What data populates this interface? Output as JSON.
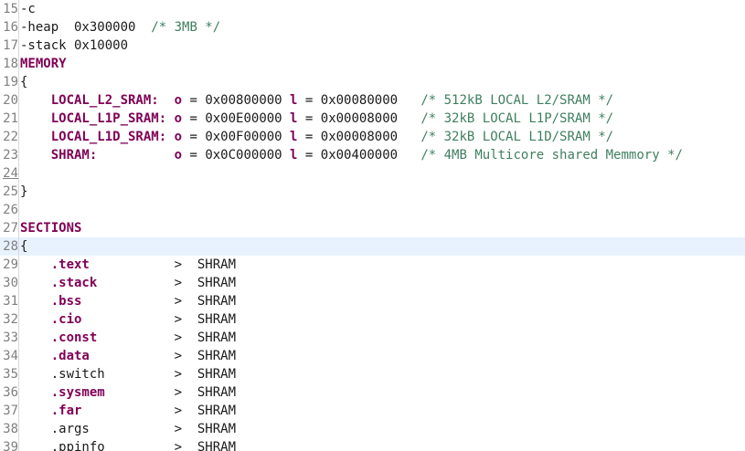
{
  "editor": {
    "current_line": 28,
    "lines": [
      {
        "num": "15",
        "parts": [
          {
            "t": "-c",
            "c": "plain"
          }
        ]
      },
      {
        "num": "16",
        "parts": [
          {
            "t": "-heap  0x300000  ",
            "c": "plain"
          },
          {
            "t": "/* 3MB */",
            "c": "cm"
          }
        ]
      },
      {
        "num": "17",
        "parts": [
          {
            "t": "-stack 0x10000",
            "c": "plain"
          }
        ]
      },
      {
        "num": "18",
        "parts": [
          {
            "t": "MEMORY",
            "c": "kw"
          }
        ]
      },
      {
        "num": "19",
        "parts": [
          {
            "t": "{",
            "c": "plain"
          }
        ]
      },
      {
        "num": "20",
        "parts": [
          {
            "t": "    ",
            "c": "plain"
          },
          {
            "t": "LOCAL_L2_SRAM:",
            "c": "kw"
          },
          {
            "t": "  ",
            "c": "plain"
          },
          {
            "t": "o",
            "c": "kw"
          },
          {
            "t": " = 0x00800000 ",
            "c": "plain"
          },
          {
            "t": "l",
            "c": "kw"
          },
          {
            "t": " = 0x00080000   ",
            "c": "plain"
          },
          {
            "t": "/* 512kB LOCAL L2/SRAM */",
            "c": "cm"
          }
        ]
      },
      {
        "num": "21",
        "parts": [
          {
            "t": "    ",
            "c": "plain"
          },
          {
            "t": "LOCAL_L1P_SRAM:",
            "c": "kw"
          },
          {
            "t": " ",
            "c": "plain"
          },
          {
            "t": "o",
            "c": "kw"
          },
          {
            "t": " = 0x00E00000 ",
            "c": "plain"
          },
          {
            "t": "l",
            "c": "kw"
          },
          {
            "t": " = 0x00008000   ",
            "c": "plain"
          },
          {
            "t": "/* 32kB LOCAL L1P/SRAM */",
            "c": "cm"
          }
        ]
      },
      {
        "num": "22",
        "parts": [
          {
            "t": "    ",
            "c": "plain"
          },
          {
            "t": "LOCAL_L1D_SRAM:",
            "c": "kw"
          },
          {
            "t": " ",
            "c": "plain"
          },
          {
            "t": "o",
            "c": "kw"
          },
          {
            "t": " = 0x00F00000 ",
            "c": "plain"
          },
          {
            "t": "l",
            "c": "kw"
          },
          {
            "t": " = 0x00008000   ",
            "c": "plain"
          },
          {
            "t": "/* 32kB LOCAL L1D/SRAM */",
            "c": "cm"
          }
        ]
      },
      {
        "num": "23",
        "parts": [
          {
            "t": "    ",
            "c": "plain"
          },
          {
            "t": "SHRAM:",
            "c": "kw"
          },
          {
            "t": "          ",
            "c": "plain"
          },
          {
            "t": "o",
            "c": "kw"
          },
          {
            "t": " = 0x0C000000 ",
            "c": "plain"
          },
          {
            "t": "l",
            "c": "kw"
          },
          {
            "t": " = 0x00400000   ",
            "c": "plain"
          },
          {
            "t": "/* 4MB Multicore shared Memmory */",
            "c": "cm"
          }
        ]
      },
      {
        "num": "24",
        "underline": true,
        "parts": []
      },
      {
        "num": "25",
        "parts": [
          {
            "t": "}",
            "c": "plain"
          }
        ]
      },
      {
        "num": "26",
        "parts": []
      },
      {
        "num": "27",
        "parts": [
          {
            "t": "SECTIONS",
            "c": "kw"
          }
        ]
      },
      {
        "num": "28",
        "parts": [
          {
            "t": "{",
            "c": "plain"
          }
        ]
      },
      {
        "num": "29",
        "parts": [
          {
            "t": "    ",
            "c": "plain"
          },
          {
            "t": ".text",
            "c": "kw"
          },
          {
            "t": "           >  SHRAM",
            "c": "plain"
          }
        ]
      },
      {
        "num": "30",
        "parts": [
          {
            "t": "    ",
            "c": "plain"
          },
          {
            "t": ".stack",
            "c": "kw"
          },
          {
            "t": "          >  SHRAM",
            "c": "plain"
          }
        ]
      },
      {
        "num": "31",
        "parts": [
          {
            "t": "    ",
            "c": "plain"
          },
          {
            "t": ".bss",
            "c": "kw"
          },
          {
            "t": "            >  SHRAM",
            "c": "plain"
          }
        ]
      },
      {
        "num": "32",
        "parts": [
          {
            "t": "    ",
            "c": "plain"
          },
          {
            "t": ".cio",
            "c": "kw"
          },
          {
            "t": "            >  SHRAM",
            "c": "plain"
          }
        ]
      },
      {
        "num": "33",
        "parts": [
          {
            "t": "    ",
            "c": "plain"
          },
          {
            "t": ".const",
            "c": "kw"
          },
          {
            "t": "          >  SHRAM",
            "c": "plain"
          }
        ]
      },
      {
        "num": "34",
        "parts": [
          {
            "t": "    ",
            "c": "plain"
          },
          {
            "t": ".data",
            "c": "kw"
          },
          {
            "t": "           >  SHRAM",
            "c": "plain"
          }
        ]
      },
      {
        "num": "35",
        "parts": [
          {
            "t": "    .switch         >  SHRAM",
            "c": "plain"
          }
        ]
      },
      {
        "num": "36",
        "parts": [
          {
            "t": "    ",
            "c": "plain"
          },
          {
            "t": ".sysmem",
            "c": "kw"
          },
          {
            "t": "         >  SHRAM",
            "c": "plain"
          }
        ]
      },
      {
        "num": "37",
        "parts": [
          {
            "t": "    ",
            "c": "plain"
          },
          {
            "t": ".far",
            "c": "kw"
          },
          {
            "t": "            >  SHRAM",
            "c": "plain"
          }
        ]
      },
      {
        "num": "38",
        "parts": [
          {
            "t": "    .args           >  SHRAM",
            "c": "plain"
          }
        ]
      },
      {
        "num": "39",
        "parts": [
          {
            "t": "    .ppinfo         >  SHRAM",
            "c": "plain"
          }
        ]
      }
    ]
  }
}
